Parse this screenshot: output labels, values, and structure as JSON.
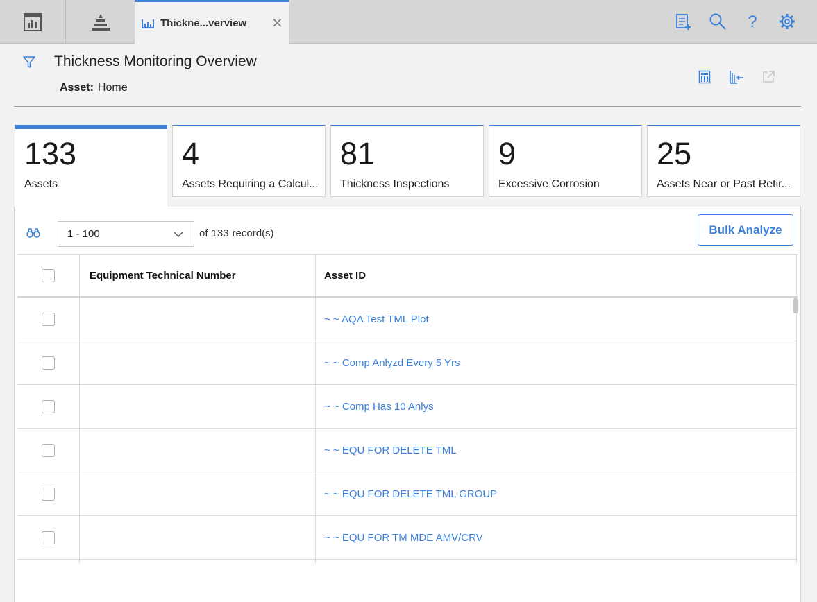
{
  "tabs": {
    "active_label": "Thickne...verview"
  },
  "header": {
    "title": "Thickness Monitoring Overview",
    "asset_key": "Asset:",
    "asset_value": "Home"
  },
  "cards": [
    {
      "value": "133",
      "label": "Assets"
    },
    {
      "value": "4",
      "label": "Assets Requiring a Calcul..."
    },
    {
      "value": "81",
      "label": "Thickness Inspections"
    },
    {
      "value": "9",
      "label": "Excessive Corrosion"
    },
    {
      "value": "25",
      "label": "Assets Near or Past Retir..."
    }
  ],
  "toolbar": {
    "range": "1 - 100",
    "of_label": "of",
    "total": "133",
    "records_label": "record(s)",
    "bulk_label": "Bulk Analyze"
  },
  "table": {
    "columns": [
      "Equipment Technical Number",
      "Asset ID"
    ],
    "rows": [
      {
        "etn": "",
        "asset_id": "~ ~ AQA Test TML Plot"
      },
      {
        "etn": "",
        "asset_id": "~ ~ Comp Anlyzd Every 5 Yrs"
      },
      {
        "etn": "",
        "asset_id": "~ ~ Comp Has 10 Anlys"
      },
      {
        "etn": "",
        "asset_id": "~ ~ EQU FOR DELETE TML"
      },
      {
        "etn": "",
        "asset_id": "~ ~ EQU FOR DELETE TML GROUP"
      },
      {
        "etn": "",
        "asset_id": "~ ~ EQU FOR TM MDE AMV/CRV"
      }
    ]
  },
  "colors": {
    "accent": "#3a7fd9",
    "topbar": "#d6d6d6"
  },
  "icons": {
    "top": [
      "dashboard-icon",
      "tree-icon",
      "report-icon",
      "search-icon",
      "help-icon",
      "settings-icon"
    ],
    "header": [
      "filter-icon",
      "calculator-icon",
      "tml-icon",
      "open-external-icon"
    ]
  }
}
